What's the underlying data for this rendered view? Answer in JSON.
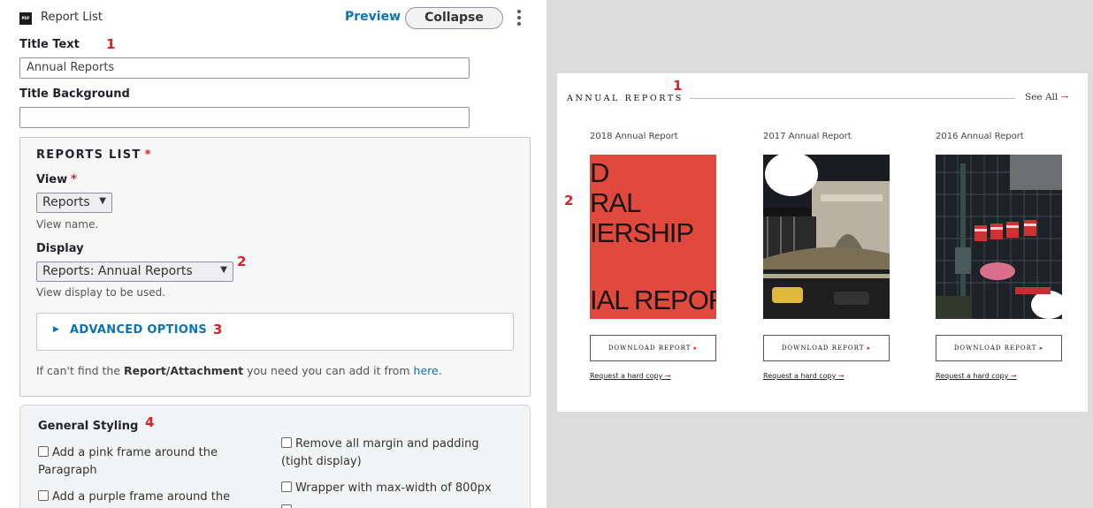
{
  "editor": {
    "header": {
      "icon": "pdf-icon",
      "icon_text": "PDF",
      "title": "Report List",
      "preview_label": "Preview",
      "collapse_label": "Collapse"
    },
    "title_text": {
      "label": "Title Text",
      "value": "Annual Reports"
    },
    "title_background": {
      "label": "Title Background",
      "value": ""
    },
    "reports_list": {
      "legend": "REPORTS LIST",
      "required_mark": "*",
      "view": {
        "label": "View",
        "required_mark": "*",
        "selected": "Reports",
        "description": "View name."
      },
      "display": {
        "label": "Display",
        "selected": "Reports: Annual Reports",
        "description": "View display to be used."
      },
      "advanced_options_label": "ADVANCED OPTIONS",
      "note_prefix": "If can't find the ",
      "note_bold": "Report/Attachment",
      "note_middle": " you need you can add it from ",
      "note_link": "here",
      "note_suffix": "."
    },
    "general_styling": {
      "title": "General Styling",
      "options": [
        "Add a pink frame around the Paragraph",
        "Remove all margin and padding (tight display)",
        "Add a purple frame around the",
        "Wrapper with max-width of 800px"
      ]
    },
    "annotations": [
      "1",
      "2",
      "3",
      "4"
    ]
  },
  "preview": {
    "section_title": "ANNUAL REPORTS",
    "see_all": "See All",
    "arrow": "→",
    "annotations": [
      "1",
      "2"
    ],
    "reports": [
      {
        "name": "2018 Annual Report",
        "cover_lines": [
          "D",
          "RAL",
          "IERSHIP",
          "IAL REPOR"
        ],
        "button": "DOWNLOAD REPORT",
        "hard_copy": "Request a hard copy"
      },
      {
        "name": "2017 Annual Report",
        "button": "DOWNLOAD REPORT",
        "hard_copy": "Request a hard copy"
      },
      {
        "name": "2016 Annual Report",
        "button": "DOWNLOAD REPORT",
        "hard_copy": "Request a hard copy"
      }
    ],
    "colors": {
      "accent_red": "#d72222",
      "cover_red": "#e2493d",
      "link_blue": "#0a73b8"
    }
  }
}
